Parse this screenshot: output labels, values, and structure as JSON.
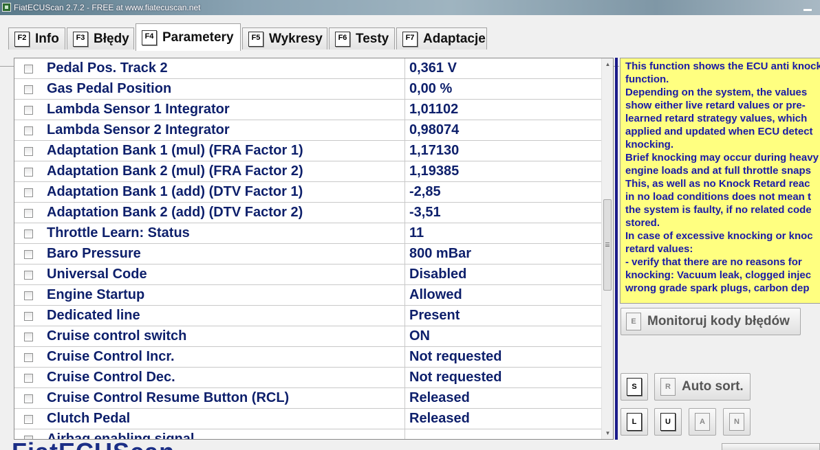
{
  "window": {
    "title": "FiatECUScan 2.7.2 - FREE at www.fiatecuscan.net"
  },
  "tabs": [
    {
      "key": "F2",
      "label": "Info"
    },
    {
      "key": "F3",
      "label": "Błędy"
    },
    {
      "key": "F4",
      "label": "Parametery",
      "active": true
    },
    {
      "key": "F5",
      "label": "Wykresy"
    },
    {
      "key": "F6",
      "label": "Testy"
    },
    {
      "key": "F7",
      "label": "Adaptacje"
    }
  ],
  "parameters": [
    {
      "name": "Pedal Pos. Track 2",
      "value": "0,361 V"
    },
    {
      "name": "Gas Pedal Position",
      "value": "0,00 %"
    },
    {
      "name": "Lambda Sensor 1 Integrator",
      "value": "1,01102"
    },
    {
      "name": "Lambda Sensor 2 Integrator",
      "value": "0,98074"
    },
    {
      "name": "Adaptation Bank 1 (mul) (FRA Factor 1)",
      "value": "1,17130"
    },
    {
      "name": "Adaptation Bank 2 (mul) (FRA Factor 2)",
      "value": "1,19385"
    },
    {
      "name": "Adaptation Bank 1 (add) (DTV Factor 1)",
      "value": "-2,85"
    },
    {
      "name": "Adaptation Bank 2 (add) (DTV Factor 2)",
      "value": "-3,51"
    },
    {
      "name": "Throttle Learn: Status",
      "value": "11"
    },
    {
      "name": "Baro Pressure",
      "value": "800 mBar"
    },
    {
      "name": "Universal Code",
      "value": "Disabled"
    },
    {
      "name": "Engine Startup",
      "value": "Allowed"
    },
    {
      "name": "Dedicated line",
      "value": "Present"
    },
    {
      "name": "Cruise control switch",
      "value": "ON"
    },
    {
      "name": "Cruise Control Incr.",
      "value": "Not requested"
    },
    {
      "name": "Cruise Control Dec.",
      "value": "Not requested"
    },
    {
      "name": "Cruise Control Resume Button (RCL)",
      "value": "Released"
    },
    {
      "name": "Clutch Pedal",
      "value": "Released"
    },
    {
      "name": "Airbag enabling signal",
      "value": ""
    }
  ],
  "info_text": "This function shows the ECU anti knock\nfunction.\nDepending on the system, the values\nshow either live retard values or pre-\nlearned retard strategy values, which\napplied and updated when ECU detect\nknocking.\nBrief knocking may occur during heavy\nengine loads and at full throttle snaps\nThis, as well as no Knock Retard reac\nin no load conditions does not mean t\nthe system is faulty, if no related code\nstored.\nIn case of excessive knocking or knoc\nretard values:\n- verify that there are no reasons for\nknocking: Vacuum leak, clogged injec\nwrong grade spark plugs, carbon dep",
  "buttons": {
    "monitor": {
      "key": "E",
      "label": "Monitoruj kody błędów"
    },
    "s": {
      "key": "S"
    },
    "autosort": {
      "key": "R",
      "label": "Auto sort."
    },
    "l": {
      "key": "L"
    },
    "u": {
      "key": "U"
    },
    "a": {
      "key": "A"
    },
    "n": {
      "key": "N"
    }
  },
  "scrollbar": {
    "position_fraction": 0.4
  },
  "bottom_logo": "FiatECUScan",
  "colors": {
    "param_text": "#0d1f6b",
    "info_bg": "#ffff80",
    "info_text": "#1a1aa6"
  },
  "icons": {
    "scroll_up": "▲",
    "scroll_down": "▼"
  }
}
